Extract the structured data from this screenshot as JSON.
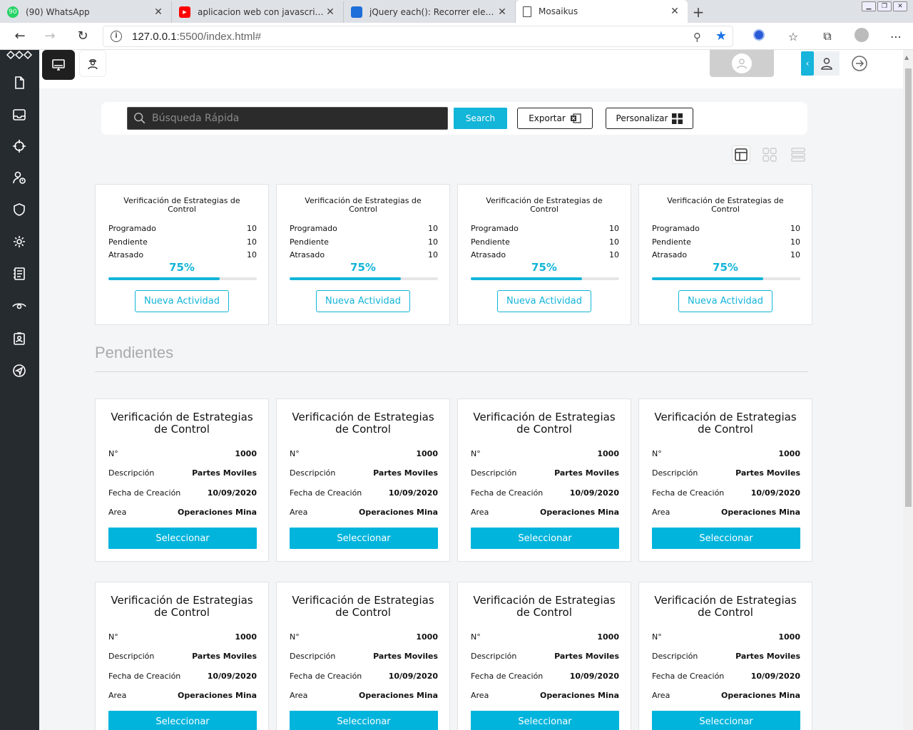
{
  "browser": {
    "tabs": [
      {
        "title": "(90) WhatsApp",
        "badge": "90",
        "favicon_color": "#25d366"
      },
      {
        "title": "aplicacion web con javascript pur",
        "favicon_color": "#ff0000"
      },
      {
        "title": "jQuery each(): Recorrer elemento",
        "favicon_color": "#1e6fd9"
      },
      {
        "title": "Mosaikus",
        "favicon_color": "#ffffff"
      }
    ],
    "url_host": "127.0.0.1",
    "url_rest": ":5500/index.html#"
  },
  "search": {
    "placeholder": "Búsqueda Rápida",
    "search_label": "Search",
    "export_label": "Exportar",
    "customize_label": "Personalizar"
  },
  "accent_color": "#13b5d8",
  "summary_cards": [
    {
      "title": "Verificación de Estrategias de Control",
      "programado_label": "Programado",
      "programado": "10",
      "pendiente_label": "Pendiente",
      "pendiente": "10",
      "atrasado_label": "Atrasado",
      "atrasado": "10",
      "percent_label": "75%",
      "progress": 0.75,
      "button": "Nueva Actividad"
    },
    {
      "title": "Verificación de Estrategias de Control",
      "programado_label": "Programado",
      "programado": "10",
      "pendiente_label": "Pendiente",
      "pendiente": "10",
      "atrasado_label": "Atrasado",
      "atrasado": "10",
      "percent_label": "75%",
      "progress": 0.75,
      "button": "Nueva Actividad"
    },
    {
      "title": "Verificación de Estrategias de Control",
      "programado_label": "Programado",
      "programado": "10",
      "pendiente_label": "Pendiente",
      "pendiente": "10",
      "atrasado_label": "Atrasado",
      "atrasado": "10",
      "percent_label": "75%",
      "progress": 0.75,
      "button": "Nueva Actividad"
    },
    {
      "title": "Verificación de Estrategias de Control",
      "programado_label": "Programado",
      "programado": "10",
      "pendiente_label": "Pendiente",
      "pendiente": "10",
      "atrasado_label": "Atrasado",
      "atrasado": "10",
      "percent_label": "75%",
      "progress": 0.75,
      "button": "Nueva Actividad"
    }
  ],
  "pending_section_title": "Pendientes",
  "pending_cards": [
    {
      "title": "Verificación de Estrategias de Control",
      "n_label": "N°",
      "n": "1000",
      "desc_label": "Descripción",
      "desc": "Partes Moviles",
      "fecha_label": "Fecha de Creación",
      "fecha": "10/09/2020",
      "area_label": "Area",
      "area": "Operaciones Mina",
      "button": "Seleccionar"
    },
    {
      "title": "Verificación de Estrategias de Control",
      "n_label": "N°",
      "n": "1000",
      "desc_label": "Descripción",
      "desc": "Partes Moviles",
      "fecha_label": "Fecha de Creación",
      "fecha": "10/09/2020",
      "area_label": "Area",
      "area": "Operaciones Mina",
      "button": "Seleccionar"
    },
    {
      "title": "Verificación de Estrategias de Control",
      "n_label": "N°",
      "n": "1000",
      "desc_label": "Descripción",
      "desc": "Partes Moviles",
      "fecha_label": "Fecha de Creación",
      "fecha": "10/09/2020",
      "area_label": "Area",
      "area": "Operaciones Mina",
      "button": "Seleccionar"
    },
    {
      "title": "Verificación de Estrategias de Control",
      "n_label": "N°",
      "n": "1000",
      "desc_label": "Descripción",
      "desc": "Partes Moviles",
      "fecha_label": "Fecha de Creación",
      "fecha": "10/09/2020",
      "area_label": "Area",
      "area": "Operaciones Mina",
      "button": "Seleccionar"
    },
    {
      "title": "Verificación de Estrategias de Control",
      "n_label": "N°",
      "n": "1000",
      "desc_label": "Descripción",
      "desc": "Partes Moviles",
      "fecha_label": "Fecha de Creación",
      "fecha": "10/09/2020",
      "area_label": "Area",
      "area": "Operaciones Mina",
      "button": "Seleccionar"
    },
    {
      "title": "Verificación de Estrategias de Control",
      "n_label": "N°",
      "n": "1000",
      "desc_label": "Descripción",
      "desc": "Partes Moviles",
      "fecha_label": "Fecha de Creación",
      "fecha": "10/09/2020",
      "area_label": "Area",
      "area": "Operaciones Mina",
      "button": "Seleccionar"
    },
    {
      "title": "Verificación de Estrategias de Control",
      "n_label": "N°",
      "n": "1000",
      "desc_label": "Descripción",
      "desc": "Partes Moviles",
      "fecha_label": "Fecha de Creación",
      "fecha": "10/09/2020",
      "area_label": "Area",
      "area": "Operaciones Mina",
      "button": "Seleccionar"
    },
    {
      "title": "Verificación de Estrategias de Control",
      "n_label": "N°",
      "n": "1000",
      "desc_label": "Descripción",
      "desc": "Partes Moviles",
      "fecha_label": "Fecha de Creación",
      "fecha": "10/09/2020",
      "area_label": "Area",
      "area": "Operaciones Mina",
      "button": "Seleccionar"
    }
  ]
}
